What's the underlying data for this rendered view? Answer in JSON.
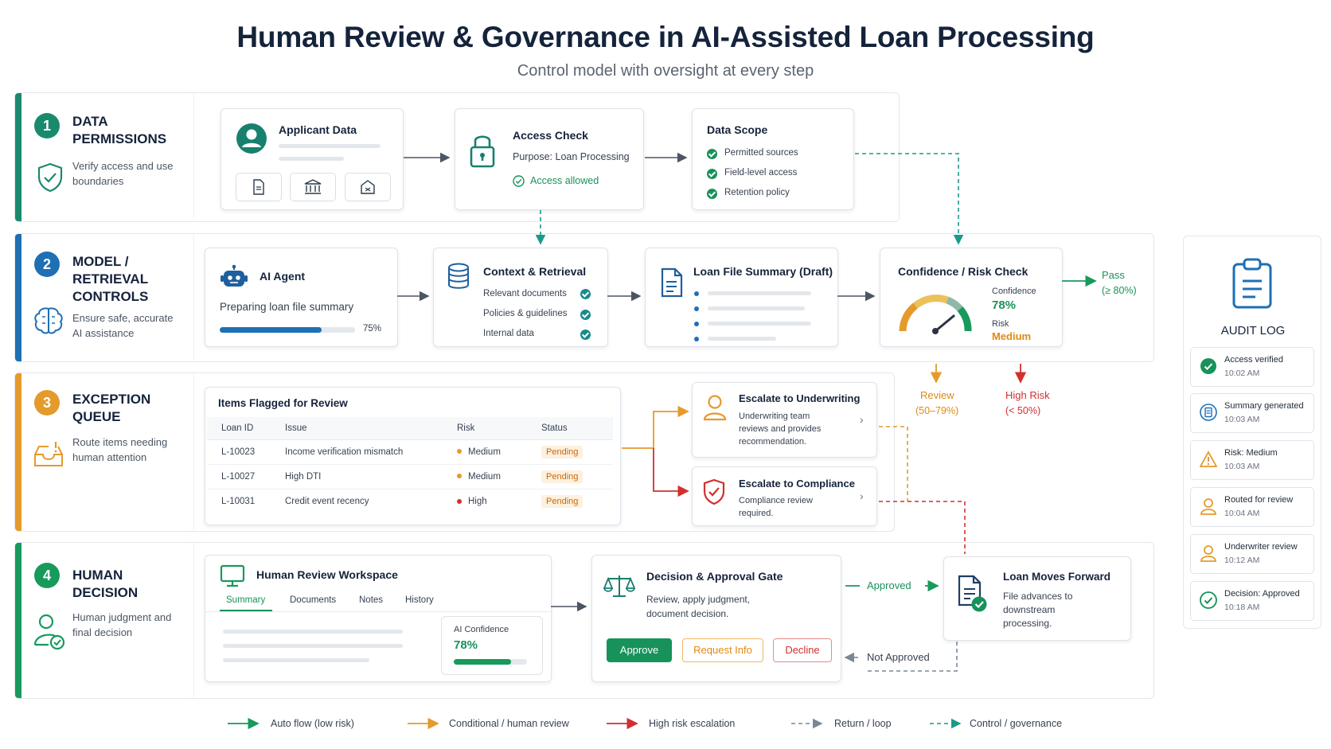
{
  "header": {
    "title": "Human Review & Governance in AI-Assisted Loan Processing",
    "subtitle": "Control model with oversight at every step"
  },
  "bands": [
    {
      "number": "1",
      "title": "DATA PERMISSIONS",
      "desc": "Verify access and use boundaries",
      "color": "#1a8a6e"
    },
    {
      "number": "2",
      "title": "MODEL / RETRIEVAL CONTROLS",
      "desc": "Ensure safe, accurate AI assistance",
      "color": "#1f6fb5"
    },
    {
      "number": "3",
      "title": "EXCEPTION QUEUE",
      "desc": "Route items needing human attention",
      "color": "#e59a2c"
    },
    {
      "number": "4",
      "title": "HUMAN DECISION",
      "desc": "Human judgment and final decision",
      "color": "#179a5c"
    }
  ],
  "band1": {
    "applicant": {
      "title": "Applicant Data"
    },
    "access": {
      "title": "Access Check",
      "purpose": "Purpose: Loan Processing",
      "status": "Access allowed"
    },
    "scope": {
      "title": "Data Scope",
      "items": [
        "Permitted sources",
        "Field-level access",
        "Retention policy"
      ]
    }
  },
  "band2": {
    "agent": {
      "title": "AI Agent",
      "status": "Preparing loan file summary",
      "progress_label": "75%",
      "progress": 0.75
    },
    "context": {
      "title": "Context & Retrieval",
      "items": [
        "Relevant documents",
        "Policies & guidelines",
        "Internal data"
      ]
    },
    "summary": {
      "title": "Loan File Summary (Draft)"
    },
    "risk": {
      "title": "Confidence / Risk Check",
      "confidence_label": "Confidence",
      "confidence_value": "78%",
      "risk_label": "Risk",
      "risk_value": "Medium",
      "gauge": 0.78
    },
    "pass": {
      "label": "Pass",
      "range": "(≥ 80%)"
    },
    "review": {
      "label": "Review",
      "range": "(50–79%)"
    },
    "high": {
      "label": "High Risk",
      "range": "(< 50%)"
    }
  },
  "band3": {
    "table_title": "Items Flagged for Review",
    "columns": [
      "Loan ID",
      "Issue",
      "Risk",
      "Status"
    ],
    "rows": [
      {
        "id": "L-10023",
        "issue": "Income verification mismatch",
        "risk": "Medium",
        "status": "Pending",
        "risk_color": "#e59a2c"
      },
      {
        "id": "L-10027",
        "issue": "High DTI",
        "risk": "Medium",
        "status": "Pending",
        "risk_color": "#e59a2c"
      },
      {
        "id": "L-10031",
        "issue": "Credit event recency",
        "risk": "High",
        "status": "Pending",
        "risk_color": "#d32f2f"
      }
    ],
    "underwriting": {
      "title": "Escalate to Underwriting",
      "desc1": "Underwriting team",
      "desc2": "reviews and provides",
      "desc3": "recommendation."
    },
    "compliance": {
      "title": "Escalate to Compliance",
      "desc1": "Compliance review",
      "desc2": "required."
    }
  },
  "band4": {
    "workspace": {
      "title": "Human Review Workspace",
      "tabs": [
        "Summary",
        "Documents",
        "Notes",
        "History"
      ],
      "ai_conf_label": "AI Confidence",
      "ai_conf_value": "78%",
      "ai_conf": 0.78
    },
    "gate": {
      "title": "Decision & Approval Gate",
      "desc1": "Review, apply judgment,",
      "desc2": "document decision.",
      "approve": "Approve",
      "request": "Request Info",
      "decline": "Decline"
    },
    "approved_label": "Approved",
    "not_approved_label": "Not Approved",
    "forward": {
      "title": "Loan Moves Forward",
      "desc1": "File advances to",
      "desc2": "downstream",
      "desc3": "processing."
    }
  },
  "audit": {
    "title": "AUDIT LOG",
    "entries": [
      {
        "text": "Access verified",
        "time": "10:02 AM",
        "icon": "check-circle-icon"
      },
      {
        "text": "Summary generated",
        "time": "10:03 AM",
        "icon": "document-icon"
      },
      {
        "text": "Risk: Medium",
        "time": "10:03 AM",
        "icon": "warning-icon"
      },
      {
        "text": "Routed for review",
        "time": "10:04 AM",
        "icon": "person-icon"
      },
      {
        "text": "Underwriter review",
        "time": "10:12 AM",
        "icon": "person-icon"
      },
      {
        "text": "Decision: Approved",
        "time": "10:18 AM",
        "icon": "check-circle-icon"
      }
    ]
  },
  "legend": [
    {
      "label": "Auto flow (low risk)",
      "color": "#179a5c",
      "style": "solid"
    },
    {
      "label": "Conditional / human review",
      "color": "#e59a2c",
      "style": "solid"
    },
    {
      "label": "High risk escalation",
      "color": "#d32f2f",
      "style": "solid"
    },
    {
      "label": "Return / loop",
      "color": "#7b8794",
      "style": "dashed"
    },
    {
      "label": "Control / governance",
      "color": "#1a9a8a",
      "style": "dashed"
    }
  ]
}
